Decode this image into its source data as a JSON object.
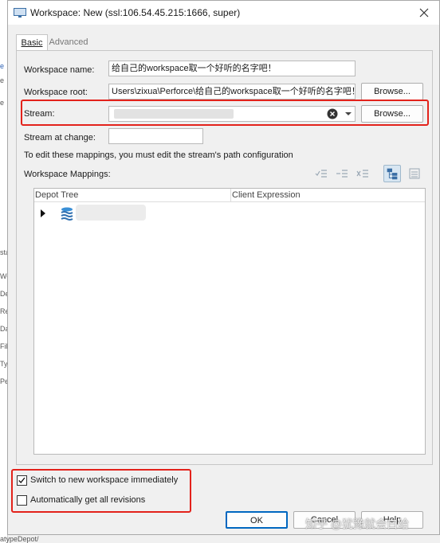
{
  "window": {
    "title": "Workspace: New (ssl:106.54.45.215:1666,  super)"
  },
  "tabs": [
    {
      "label": "Basic"
    },
    {
      "label": "Advanced"
    }
  ],
  "form": {
    "workspace_name_label": "Workspace name:",
    "workspace_name_value": "给自己的workspace取一个好听的名字吧！",
    "workspace_root_label": "Workspace root:",
    "workspace_root_value": "Users\\zixua\\Perforce\\给自己的workspace取一个好听的名字吧！",
    "browse_label": "Browse...",
    "stream_label": "Stream:",
    "stream_at_change_label": "Stream at change:",
    "stream_at_change_value": "",
    "mapping_note": "To edit these mappings, you must edit the stream's path configuration",
    "mappings_label": "Workspace Mappings:"
  },
  "tree": {
    "columns": [
      "Depot Tree",
      "Client Expression"
    ]
  },
  "options": {
    "switch_label": "Switch to new workspace immediately",
    "switch_checked": true,
    "get_all_label": "Automatically get all revisions",
    "get_all_checked": false
  },
  "buttons": {
    "ok": "OK",
    "cancel": "Cancel",
    "help": "Help"
  },
  "watermark": "知乎 @犹豫就会白给",
  "background": {
    "side_letters": [
      "e",
      "e",
      "e",
      "sta",
      "Wo",
      "De",
      "Re",
      "Da",
      "File",
      "Ty",
      "Pe"
    ],
    "bottom_text": "atypeDepot/"
  },
  "colors": {
    "highlight_box": "#e3221b",
    "active_tool": "#d8e6f2"
  }
}
